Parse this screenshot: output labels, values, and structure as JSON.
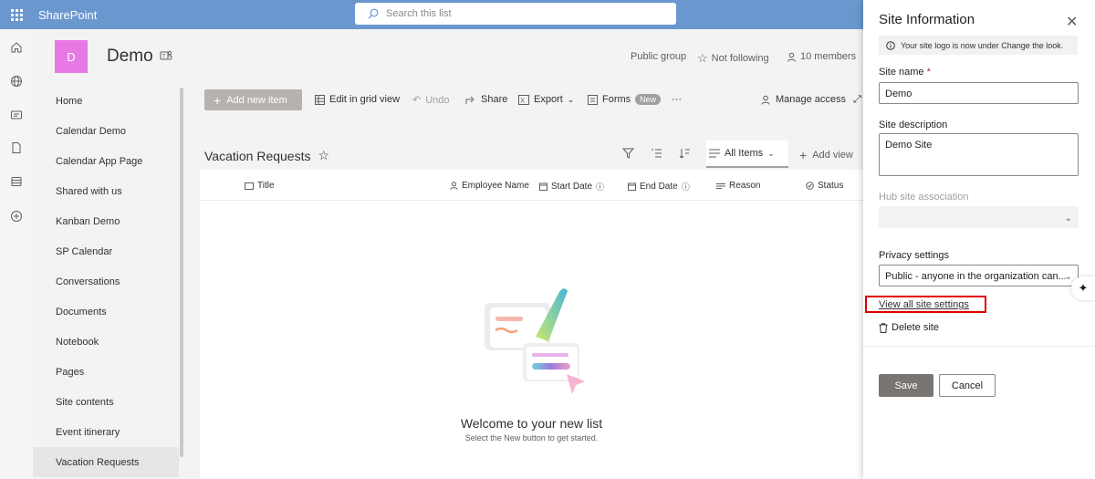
{
  "suite": {
    "brand": "SharePoint",
    "search_placeholder": "Search this list"
  },
  "site": {
    "logo_letter": "D",
    "title": "Demo",
    "group_type": "Public group",
    "follow_label": "Not following",
    "members_label": "10 members"
  },
  "leftnav": {
    "items": [
      {
        "label": "Home"
      },
      {
        "label": "Calendar Demo"
      },
      {
        "label": "Calendar App Page"
      },
      {
        "label": "Shared with us"
      },
      {
        "label": "Kanban Demo"
      },
      {
        "label": "SP Calendar"
      },
      {
        "label": "Conversations"
      },
      {
        "label": "Documents"
      },
      {
        "label": "Notebook"
      },
      {
        "label": "Pages"
      },
      {
        "label": "Site contents"
      },
      {
        "label": "Event itinerary"
      },
      {
        "label": "Vacation Requests"
      }
    ],
    "selected": "Vacation Requests"
  },
  "commandbar": {
    "add_new_item": "Add new item",
    "edit_grid": "Edit in grid view",
    "undo": "Undo",
    "share": "Share",
    "export": "Export",
    "forms": "Forms",
    "forms_badge": "New",
    "more": "···",
    "manage_access": "Manage access"
  },
  "list": {
    "title": "Vacation Requests",
    "view_name": "All Items",
    "add_view": "Add view",
    "columns": [
      "Title",
      "Employee Name",
      "Start Date",
      "End Date",
      "Reason",
      "Status"
    ],
    "empty_title": "Welcome to your new list",
    "empty_subtitle": "Select the New button to get started."
  },
  "panel": {
    "title": "Site Information",
    "info_message": "Your site logo is now under Change the look.",
    "site_name_label": "Site name",
    "required_mark": "*",
    "site_name_value": "Demo",
    "site_description_label": "Site description",
    "site_description_value": "Demo Site",
    "hub_label": "Hub site association",
    "privacy_label": "Privacy settings",
    "privacy_value": "Public - anyone in the organization can...",
    "view_all_link": "View all site settings",
    "delete_site": "Delete site",
    "save": "Save",
    "cancel": "Cancel"
  },
  "colors": {
    "suitebar": "#6b97cf",
    "site_logo": "#e879e4",
    "highlight_box": "#e00000"
  }
}
